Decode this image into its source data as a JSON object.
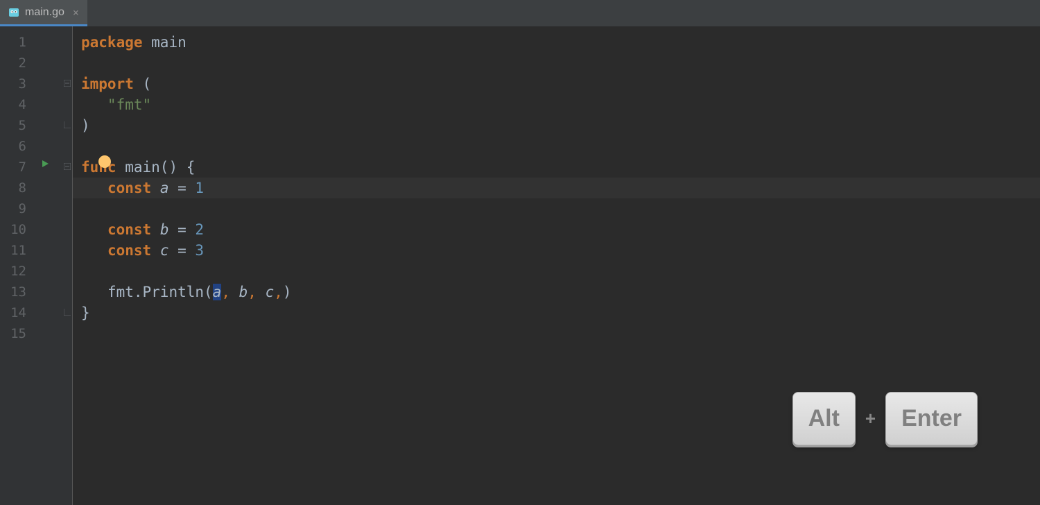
{
  "tab": {
    "filename": "main.go",
    "close": "×"
  },
  "gutter": {
    "lines": [
      "1",
      "2",
      "3",
      "4",
      "5",
      "6",
      "7",
      "8",
      "9",
      "10",
      "11",
      "12",
      "13",
      "14",
      "15"
    ]
  },
  "code": {
    "l1_kw": "package",
    "l1_ident": " main",
    "l3_kw": "import",
    "l3_rest": " (",
    "l4_str": "   \"fmt\"",
    "l5": ")",
    "l7_kw": "func",
    "l7_ident": " main",
    "l7_parens": "() {",
    "l8_indent": "   ",
    "l8_kw": "const",
    "l8_sp": " ",
    "l8_var": "a",
    "l8_eq": " = ",
    "l8_num": "1",
    "l10_indent": "   ",
    "l10_kw": "const",
    "l10_sp": " ",
    "l10_var": "b",
    "l10_eq": " = ",
    "l10_num": "2",
    "l11_indent": "   ",
    "l11_kw": "const",
    "l11_sp": " ",
    "l11_var": "c",
    "l11_eq": " = ",
    "l11_num": "3",
    "l13_indent": "   ",
    "l13_fmt": "fmt.Println(",
    "l13_a": "a",
    "l13_c1": ", ",
    "l13_b": "b",
    "l13_c2": ", ",
    "l13_c": "c",
    "l13_c3": ",",
    "l13_close": ")",
    "l14": "}"
  },
  "shortcut": {
    "key1": "Alt",
    "plus": "+",
    "key2": "Enter"
  }
}
